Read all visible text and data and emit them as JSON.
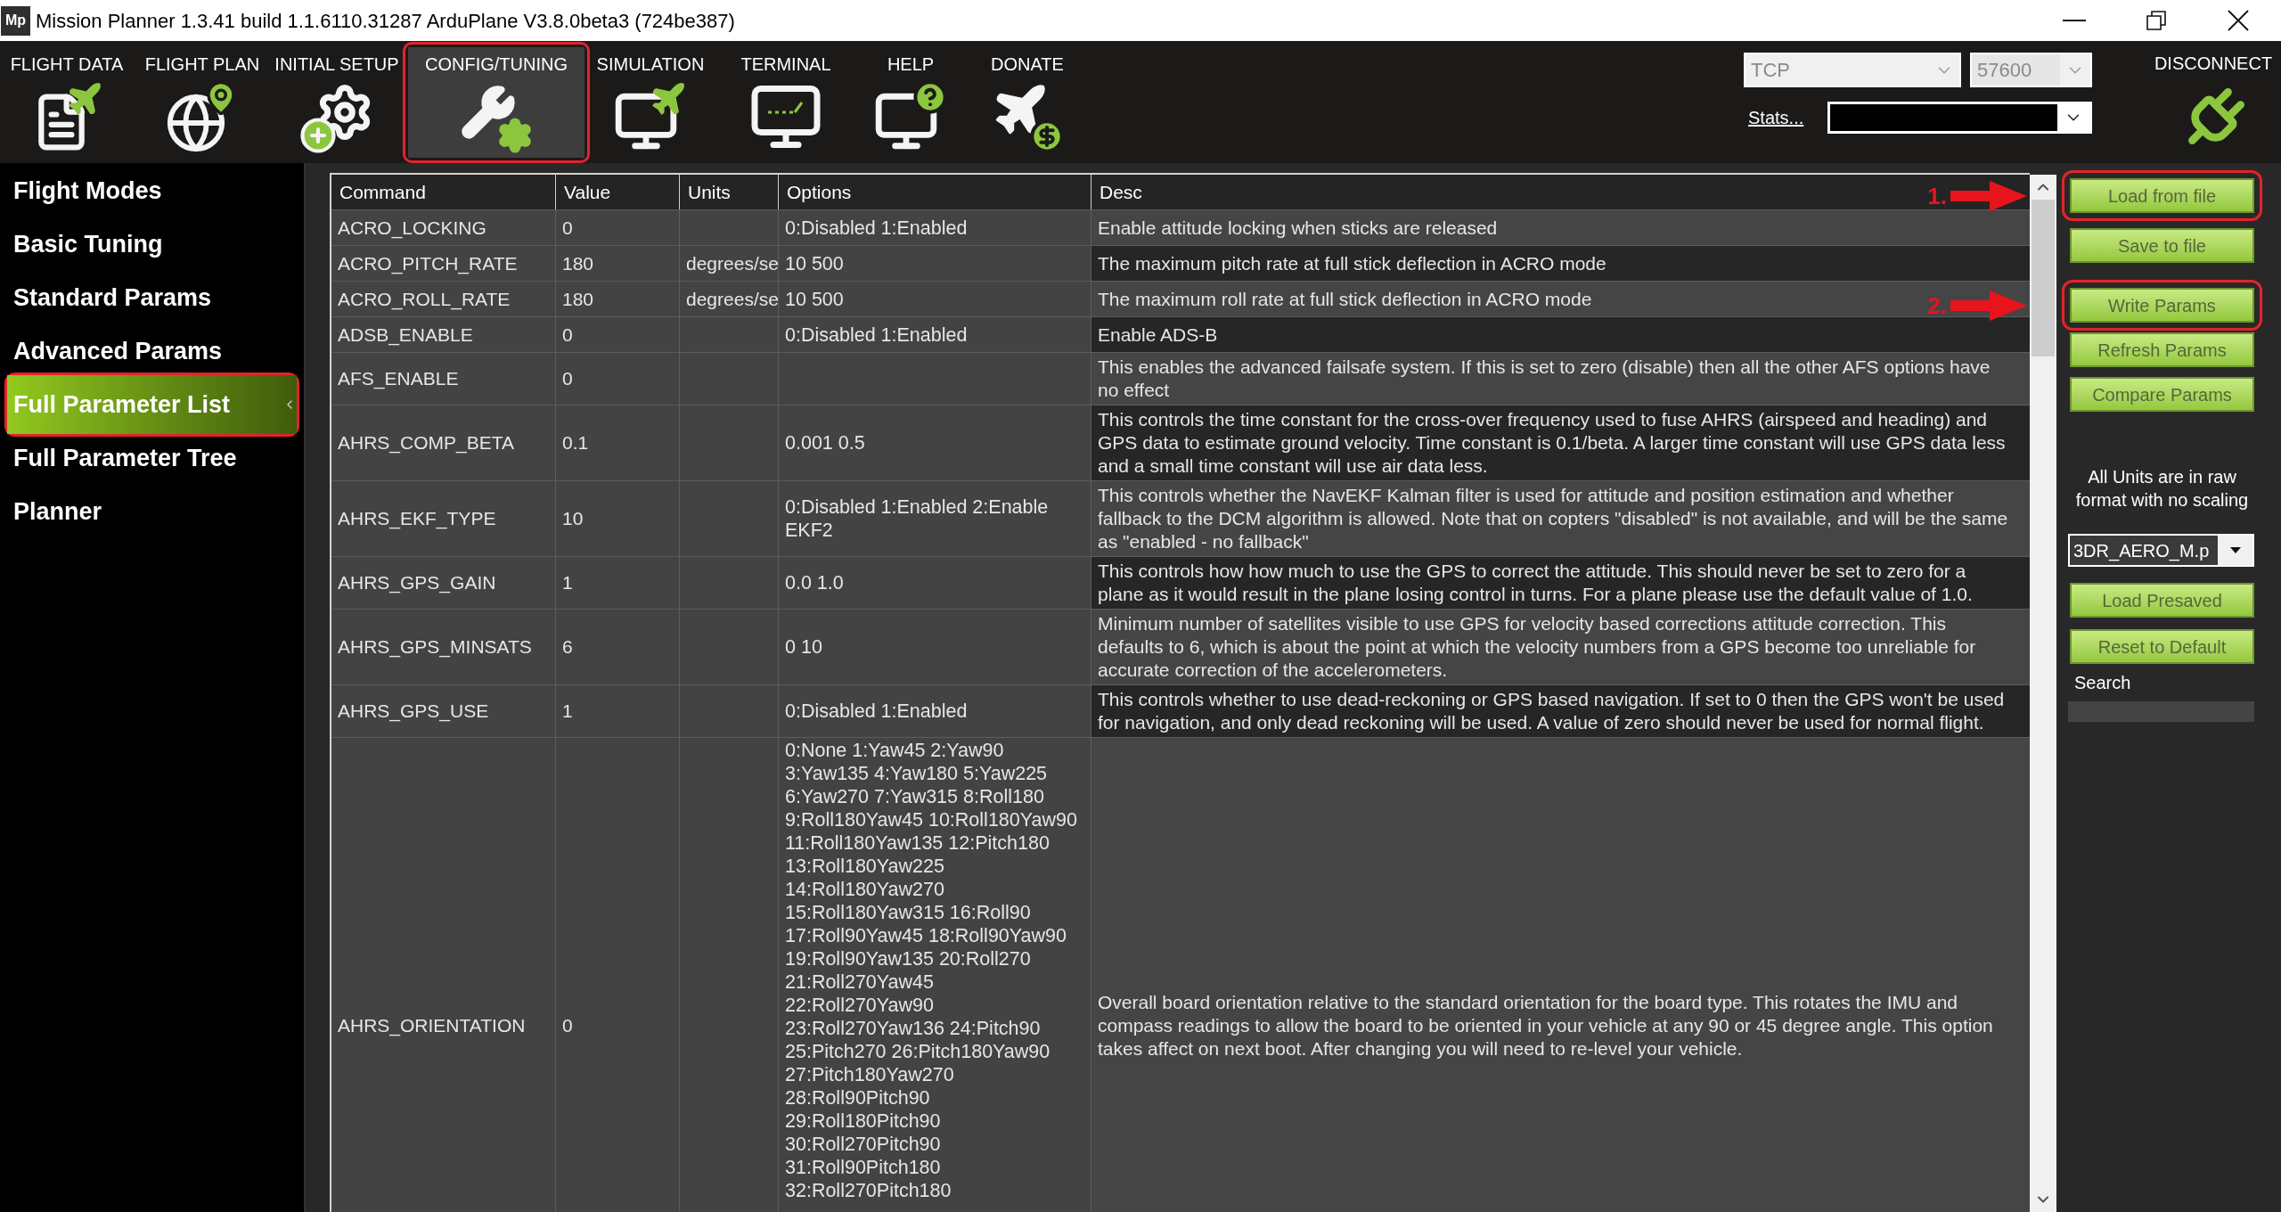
{
  "window": {
    "logo": "Mp",
    "title": "Mission Planner 1.3.41 build 1.1.6110.31287 ArduPlane V3.8.0beta3 (724be387)"
  },
  "menu": [
    {
      "label": "FLIGHT DATA",
      "selected": false,
      "highlighted": false
    },
    {
      "label": "FLIGHT PLAN",
      "selected": false,
      "highlighted": false
    },
    {
      "label": "INITIAL SETUP",
      "selected": false,
      "highlighted": false
    },
    {
      "label": "CONFIG/TUNING",
      "selected": true,
      "highlighted": true
    },
    {
      "label": "SIMULATION",
      "selected": false,
      "highlighted": false
    },
    {
      "label": "TERMINAL",
      "selected": false,
      "highlighted": false
    },
    {
      "label": "HELP",
      "selected": false,
      "highlighted": false
    },
    {
      "label": "DONATE",
      "selected": false,
      "highlighted": false
    }
  ],
  "connection": {
    "port": "TCP",
    "baud": "57600",
    "stats_link": "Stats...",
    "disconnect": "DISCONNECT"
  },
  "sidebar": {
    "items": [
      {
        "label": "Flight Modes",
        "selected": false,
        "highlighted": false
      },
      {
        "label": "Basic Tuning",
        "selected": false,
        "highlighted": false
      },
      {
        "label": "Standard Params",
        "selected": false,
        "highlighted": false
      },
      {
        "label": "Advanced Params",
        "selected": false,
        "highlighted": false
      },
      {
        "label": "Full Parameter List",
        "selected": true,
        "highlighted": true
      },
      {
        "label": "Full Parameter Tree",
        "selected": false,
        "highlighted": false
      },
      {
        "label": "Planner",
        "selected": false,
        "highlighted": false
      }
    ]
  },
  "table": {
    "columns": [
      "Command",
      "Value",
      "Units",
      "Options",
      "Desc"
    ],
    "rows": [
      {
        "command": "ACRO_LOCKING",
        "value": "0",
        "options": "0:Disabled 1:Enabled",
        "desc": "Enable attitude locking when sticks are released"
      },
      {
        "command": "ACRO_PITCH_RATE",
        "value": "180",
        "units": "degrees/se",
        "options": "10 500",
        "desc": "The maximum pitch rate at full stick deflection in ACRO mode"
      },
      {
        "command": "ACRO_ROLL_RATE",
        "value": "180",
        "units": "degrees/se",
        "options": "10 500",
        "desc": "The maximum roll rate at full stick deflection in ACRO mode"
      },
      {
        "command": "ADSB_ENABLE",
        "value": "0",
        "options": "0:Disabled 1:Enabled",
        "desc": "Enable ADS-B"
      },
      {
        "command": "AFS_ENABLE",
        "value": "0",
        "desc": "This enables the advanced failsafe system. If this is set to zero (disable) then all the other AFS options have no effect"
      },
      {
        "command": "AHRS_COMP_BETA",
        "value": "0.1",
        "options": "0.001 0.5",
        "desc": "This controls the time constant for the cross-over frequency used to fuse AHRS (airspeed and heading) and GPS data to estimate ground velocity. Time constant is 0.1/beta. A larger time constant will use GPS data less and a small time constant will use air data less."
      },
      {
        "command": "AHRS_EKF_TYPE",
        "value": "10",
        "options": "0:Disabled 1:Enabled 2:Enable EKF2",
        "desc": "This controls whether the NavEKF Kalman filter is used for attitude and position estimation and whether fallback to the DCM algorithm is allowed. Note that on copters \"disabled\" is not available, and will be the same as \"enabled - no fallback\""
      },
      {
        "command": "AHRS_GPS_GAIN",
        "value": "1",
        "options": "0.0 1.0",
        "desc": "This controls how how much to use the GPS to correct the attitude. This should never be set to zero for a plane as it would result in the plane losing control in turns. For a plane please use the default value of 1.0."
      },
      {
        "command": "AHRS_GPS_MINSATS",
        "value": "6",
        "options": "0 10",
        "desc": "Minimum number of satellites visible to use GPS for velocity based corrections attitude correction. This defaults to 6, which is about the point at which the velocity numbers from a GPS become too unreliable for accurate correction of the accelerometers."
      },
      {
        "command": "AHRS_GPS_USE",
        "value": "1",
        "options": "0:Disabled 1:Enabled",
        "desc": "This controls whether to use dead-reckoning or GPS based navigation. If set to 0 then the GPS won't be used for navigation, and only dead reckoning will be used. A value of zero should never be used for normal flight."
      },
      {
        "command": "AHRS_ORIENTATION",
        "value": "0",
        "options": "0:None 1:Yaw45 2:Yaw90 3:Yaw135 4:Yaw180 5:Yaw225 6:Yaw270 7:Yaw315 8:Roll180 9:Roll180Yaw45 10:Roll180Yaw90 11:Roll180Yaw135 12:Pitch180 13:Roll180Yaw225 14:Roll180Yaw270 15:Roll180Yaw315 16:Roll90 17:Roll90Yaw45 18:Roll90Yaw90 19:Roll90Yaw135 20:Roll270 21:Roll270Yaw45 22:Roll270Yaw90 23:Roll270Yaw136 24:Pitch90 25:Pitch270 26:Pitch180Yaw90 27:Pitch180Yaw270 28:Roll90Pitch90 29:Roll180Pitch90 30:Roll270Pitch90 31:Roll90Pitch180 32:Roll270Pitch180",
        "desc": "Overall board orientation relative to the standard orientation for the board type. This rotates the IMU and compass readings to allow the board to be oriented in your vehicle at any 90 or 45 degree angle. This option takes affect on next boot. After changing you will need to re-level your vehicle."
      }
    ]
  },
  "side_panel": {
    "file_buttons": [
      {
        "label": "Load from file",
        "highlighted": true,
        "annotation": "1."
      },
      {
        "label": "Save to file",
        "highlighted": false
      }
    ],
    "param_buttons": [
      {
        "label": "Write Params",
        "highlighted": true,
        "annotation": "2."
      },
      {
        "label": "Refresh Params",
        "highlighted": false
      },
      {
        "label": "Compare Params",
        "highlighted": false
      }
    ],
    "note": "All Units are in raw format with no scaling",
    "preset": "3DR_AERO_M.p",
    "preset_buttons": [
      {
        "label": "Load Presaved",
        "highlighted": false
      },
      {
        "label": "Reset to Default",
        "highlighted": false
      }
    ],
    "search_label": "Search"
  }
}
